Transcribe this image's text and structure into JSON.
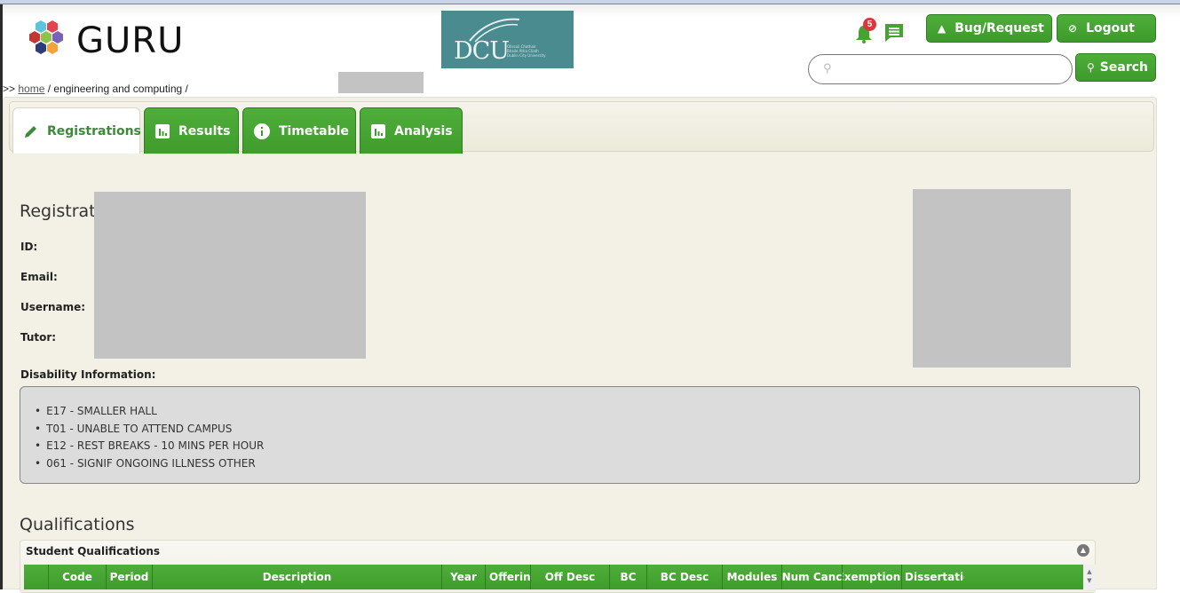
{
  "app": {
    "logo_text": "GURU",
    "logo_icon": "hexagon-cluster-logo",
    "partner_logo": {
      "letters": "DCU",
      "subtitle": [
        "Ollscoil Chathair",
        "Bhaile Átha Cliath",
        "Dublin City University"
      ],
      "color": "#4a8b90"
    }
  },
  "breadcrumb": {
    "prefix": ">>",
    "home": "home",
    "path": " / engineering and computing /"
  },
  "header": {
    "notifications": {
      "icon": "bell-icon",
      "count": "5"
    },
    "messages": {
      "icon": "chat-icon"
    },
    "bug_button": {
      "label": "Bug/Request",
      "icon": "warning-icon"
    },
    "logout_button": {
      "label": "Logout",
      "icon": "ban-icon"
    },
    "search": {
      "placeholder": "",
      "value": "",
      "button_label": "Search",
      "icon": "search-icon"
    }
  },
  "tabs": [
    {
      "label": "Registrations",
      "icon": "pencil-icon",
      "active": true
    },
    {
      "label": "Results",
      "icon": "bar-chart-icon",
      "active": false
    },
    {
      "label": "Timetable",
      "icon": "info-icon",
      "active": false
    },
    {
      "label": "Analysis",
      "icon": "bar-chart-icon",
      "active": false
    }
  ],
  "registration": {
    "heading": "Registrat",
    "fields": [
      {
        "label": "ID:",
        "value": ""
      },
      {
        "label": "Email:",
        "value": ""
      },
      {
        "label": "Username:",
        "value": ""
      },
      {
        "label": "Tutor:",
        "value": ""
      }
    ],
    "disability_label": "Disability Information:",
    "disability_items": [
      "E17 - SMALLER HALL",
      "T01 - UNABLE TO ATTEND CAMPUS",
      "E12 - REST BREAKS - 10 MINS PER HOUR",
      "061 - SIGNIF ONGOING ILLNESS OTHER"
    ]
  },
  "qualifications": {
    "heading": "Qualifications",
    "grid_title": "Student Qualifications",
    "columns": [
      "",
      "Code",
      "Period",
      "Description",
      "Year",
      "Offering",
      "Off Desc",
      "BC",
      "BC Desc",
      "Modules",
      "Num Canc",
      "Exemptions",
      "Dissertation"
    ],
    "rows": []
  },
  "colors": {
    "brand_green": "#45a332",
    "panel_bg": "#f3f1e6",
    "redaction_gray": "#c3c3c3",
    "badge_red": "#d9363e"
  }
}
